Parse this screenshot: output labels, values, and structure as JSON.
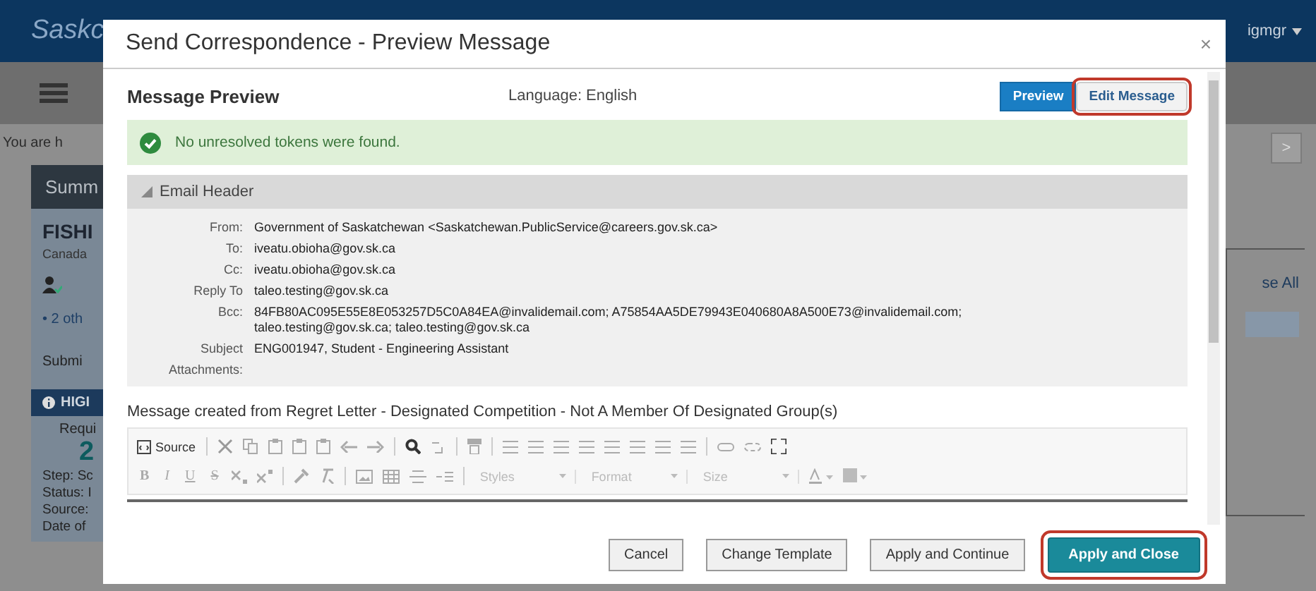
{
  "background": {
    "logo": "Saskc",
    "user": "igmgr",
    "breadcrumb": "You are h",
    "summary_title": "Summ",
    "card_title": "FISHI",
    "card_subtitle": "Canada",
    "bullet_item": "• 2 oth",
    "submit_label": "Submi",
    "highlight_title": "HIGI",
    "requisition_label": "Requi",
    "requisition_count": "2",
    "details": [
      "Step: Sc",
      "Status: I",
      "Source:",
      "Date of"
    ],
    "next_button": ">",
    "collapse_link": "se All"
  },
  "dialog": {
    "title": "Send Correspondence - Preview Message",
    "close": "×",
    "heading": "Message Preview",
    "language": "Language: English",
    "view_tabs": [
      {
        "label": "Preview",
        "selected": true,
        "highlighted": false
      },
      {
        "label": "Edit Message",
        "selected": false,
        "highlighted": true
      }
    ],
    "alert": "No unresolved tokens were found.",
    "section_title": "Email Header",
    "expanded": true,
    "fields": [
      {
        "label": "From:",
        "value": "Government of Saskatchewan <Saskatchewan.PublicService@careers.gov.sk.ca>"
      },
      {
        "label": "To:",
        "value": "iveatu.obioha@gov.sk.ca"
      },
      {
        "label": "Cc:",
        "value": "iveatu.obioha@gov.sk.ca"
      },
      {
        "label": "Reply To",
        "value": "taleo.testing@gov.sk.ca"
      },
      {
        "label": "Bcc:",
        "value": "84FB80AC095E55E8E053257D5C0A84EA@invalidemail.com; A75854AA5DE79943E040680A8A500E73@invalidemail.com; taleo.testing@gov.sk.ca; taleo.testing@gov.sk.ca"
      },
      {
        "label": "Subject",
        "value": "ENG001947, Student - Engineering Assistant"
      },
      {
        "label": "Attachments:"
      }
    ],
    "template_note": "Message created from Regret Letter - Designated Competition - Not A Member Of Designated Group(s)",
    "editor": {
      "source": "Source",
      "format_letters": [
        "B",
        "I",
        "U",
        "S"
      ],
      "dropdowns": [
        "Styles",
        "Format",
        "Size"
      ]
    },
    "buttons": [
      {
        "label": "Cancel",
        "kind": "default",
        "highlighted": false
      },
      {
        "label": "Change Template",
        "kind": "default",
        "highlighted": false
      },
      {
        "label": "Apply and Continue",
        "kind": "default",
        "highlighted": false
      },
      {
        "label": "Apply and Close",
        "kind": "primary",
        "highlighted": true
      }
    ]
  }
}
